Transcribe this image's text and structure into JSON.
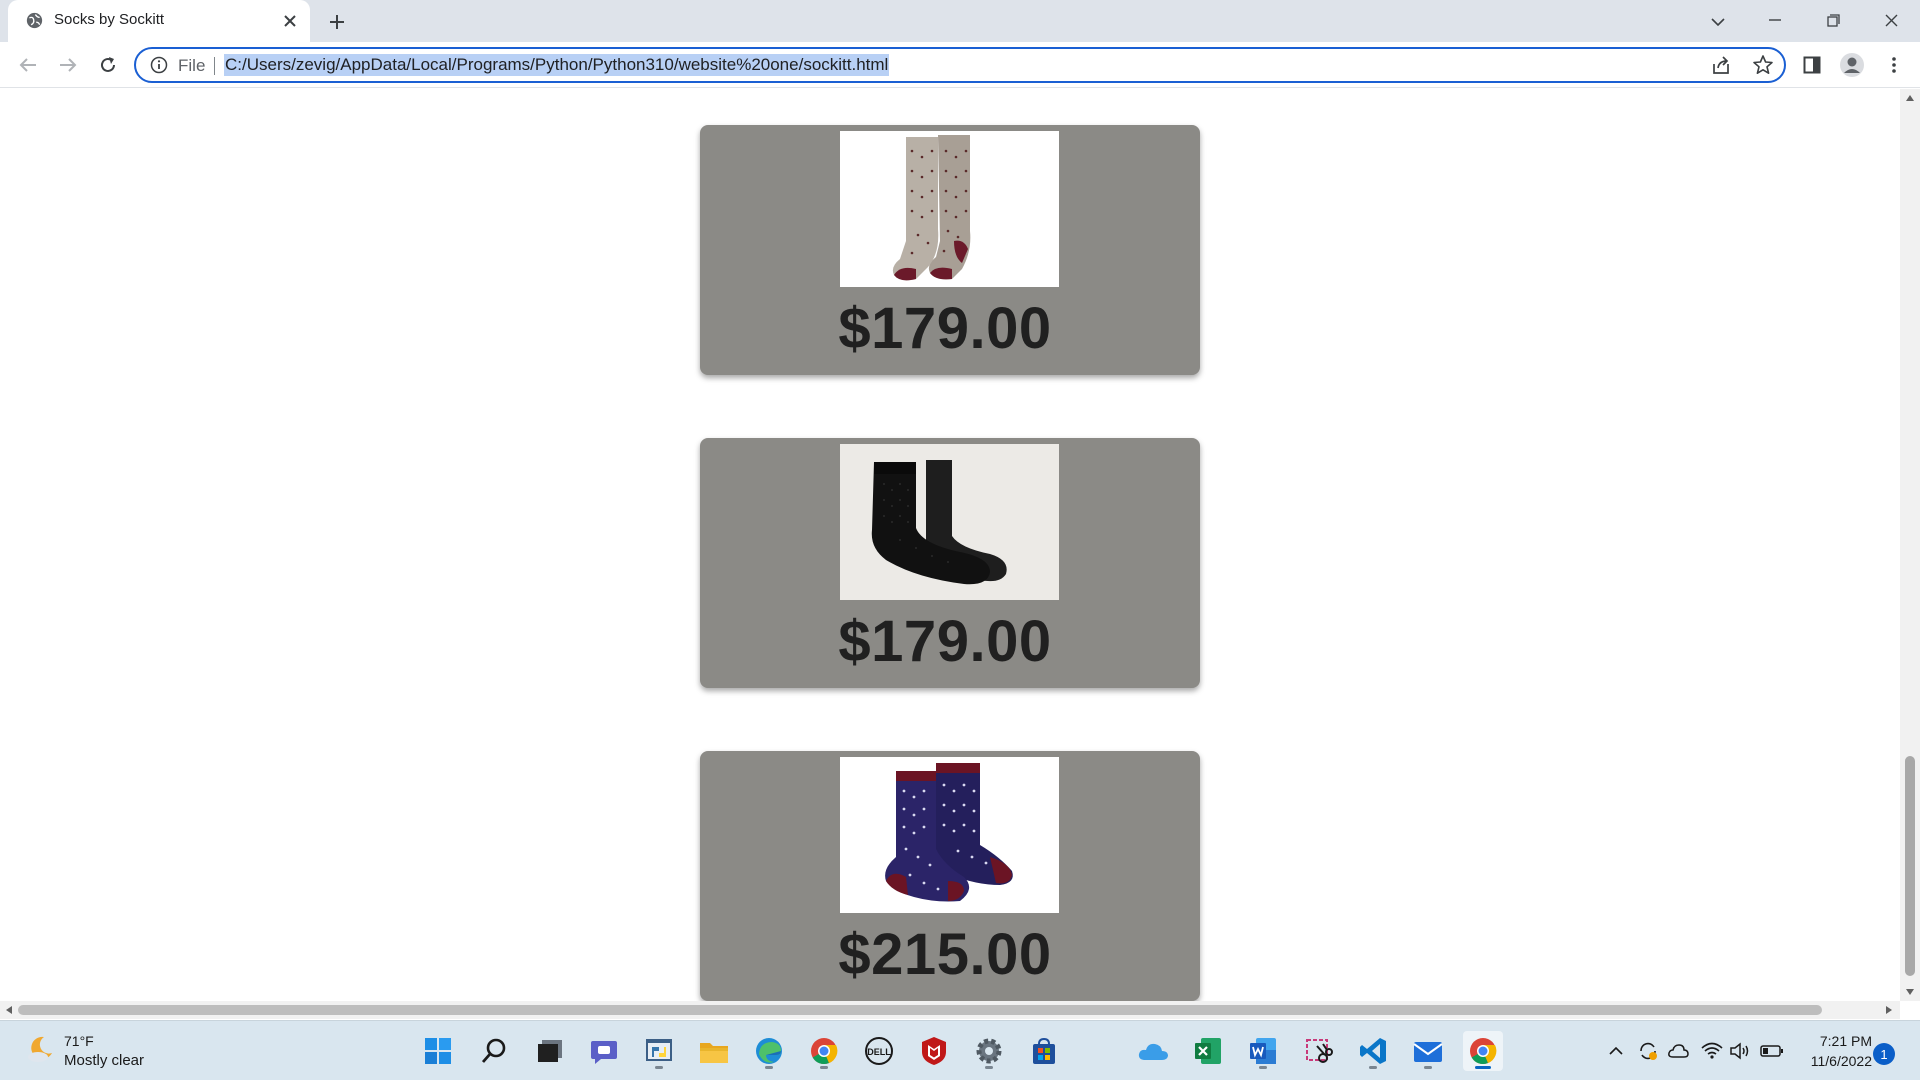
{
  "browser": {
    "tab_title": "Socks by Sockitt",
    "file_label": "File",
    "url": "C:/Users/zevig/AppData/Local/Programs/Python/Python310/website%20one/sockitt.html"
  },
  "products": [
    {
      "price": "$179.00",
      "image": "beige-polka-dot-socks"
    },
    {
      "price": "$179.00",
      "image": "black-textured-socks"
    },
    {
      "price": "$215.00",
      "image": "navy-polka-dot-socks"
    }
  ],
  "taskbar": {
    "weather_temp": "71°F",
    "weather_desc": "Mostly clear",
    "time": "7:21 PM",
    "date": "11/6/2022",
    "notification_count": "1"
  },
  "colors": {
    "card": "#8b8a86",
    "omnibox_border": "#1a5fd3",
    "url_selection": "#b8d0f5"
  }
}
